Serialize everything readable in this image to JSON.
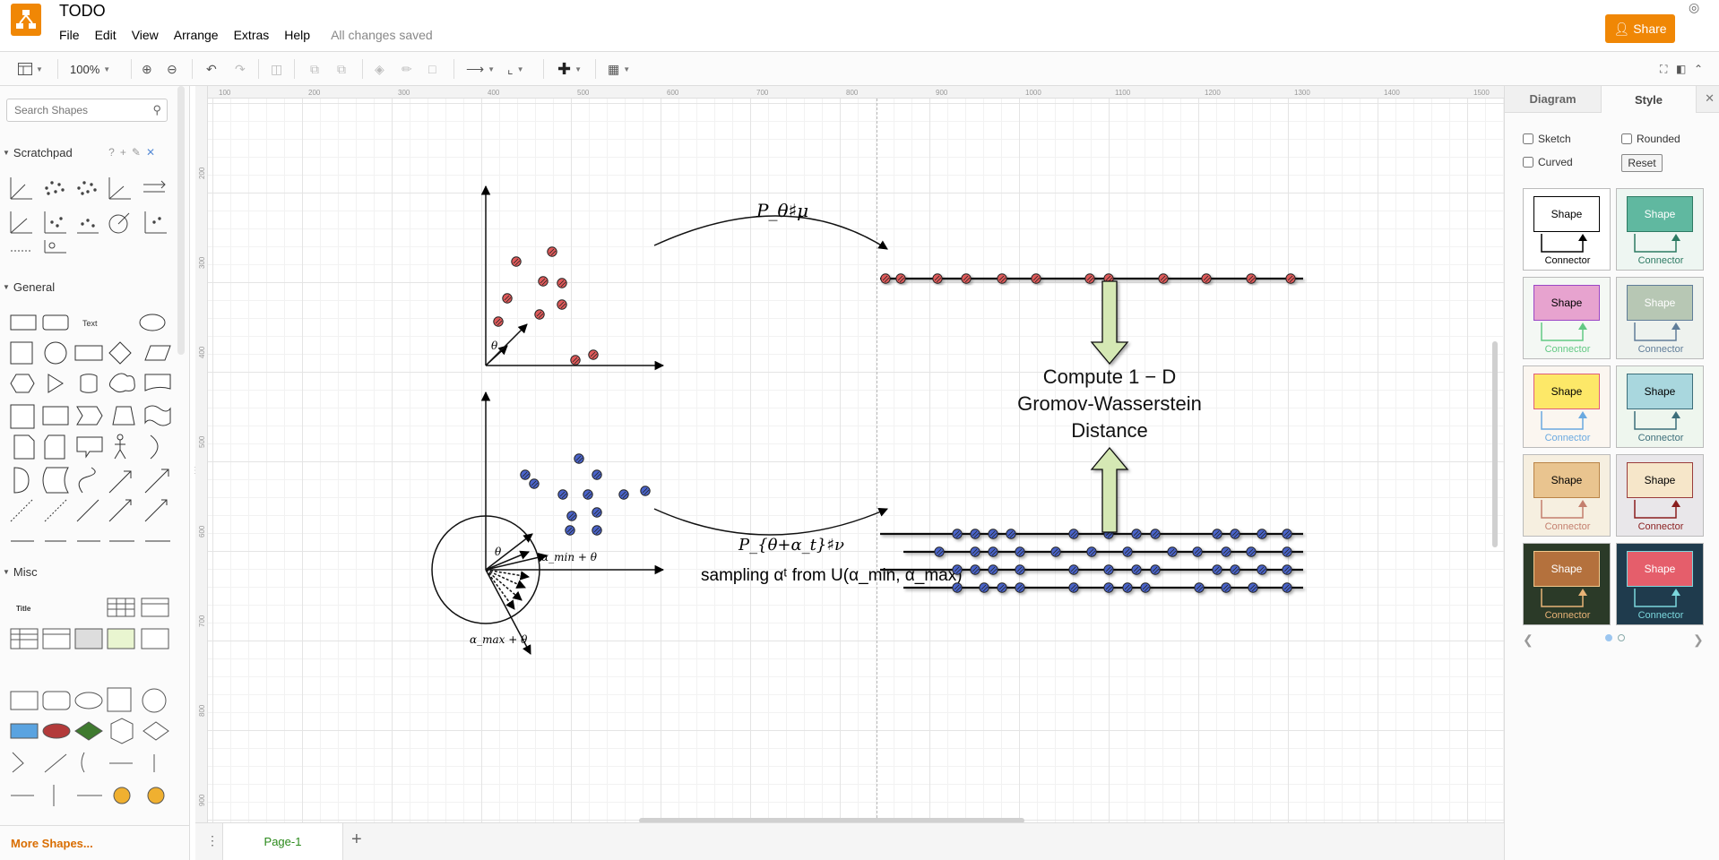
{
  "app": {
    "title": "TODO",
    "menus": [
      "File",
      "Edit",
      "View",
      "Arrange",
      "Extras",
      "Help"
    ],
    "save_status": "All changes saved",
    "share_label": "Share",
    "brand_color": "#f08705"
  },
  "toolbar": {
    "zoom": "100%",
    "icons": [
      "format-panel-icon",
      "zoom-in-icon",
      "zoom-out-icon",
      "undo-icon",
      "redo-icon",
      "delete-icon",
      "to-front-icon",
      "to-back-icon",
      "fill-color-icon",
      "line-color-icon",
      "shadow-icon",
      "connection-icon",
      "waypoints-icon",
      "insert-icon",
      "table-icon",
      "fullscreen-icon",
      "toggle-panel-icon",
      "collapse-icon"
    ]
  },
  "sidebar": {
    "search_placeholder": "Search Shapes",
    "palettes": [
      "Scratchpad",
      "General",
      "Misc"
    ],
    "general_text_label": "Text",
    "misc_title_label": "Title",
    "more_shapes": "More Shapes..."
  },
  "ruler": {
    "top": [
      "100",
      "200",
      "300",
      "400",
      "500",
      "600",
      "700",
      "800",
      "900",
      "1000",
      "1100",
      "1200",
      "1300",
      "1400",
      "1500"
    ],
    "left": [
      "200",
      "300",
      "400",
      "500",
      "600",
      "700",
      "800",
      "900"
    ]
  },
  "diagram": {
    "top_arrow_label": "P_θ♯μ",
    "bottom_arrow_label": "P_{θ+α_t}♯ν",
    "sampling_text": "sampling αᵗ from U(α_min, α_max)",
    "compute_lines": [
      "Compute 1 − D",
      "Gromov-Wasserstein",
      "Distance"
    ],
    "theta_label": "θ",
    "alpha_min_label": "α_min + θ",
    "alpha_max_label": "α_max + θ",
    "red_point_color": "#e05a5a",
    "blue_point_color": "#4a63c9",
    "arrow_fill": "#d5e8b4"
  },
  "pages": {
    "current": "Page-1"
  },
  "format_panel": {
    "tabs": [
      "Diagram",
      "Style"
    ],
    "active_tab": "Style",
    "options": [
      "Sketch",
      "Rounded",
      "Curved"
    ],
    "reset_label": "Reset",
    "shape_label": "Shape",
    "connector_label": "Connector",
    "styles": [
      {
        "fill": "#ffffff",
        "stroke": "#000000",
        "text": "#000000",
        "conn": "#000000",
        "bg": "#ffffff"
      },
      {
        "fill": "#60b8a0",
        "stroke": "#2d7a63",
        "text": "#ffffff",
        "conn": "#2d7a63",
        "bg": "#eef6f2"
      },
      {
        "fill": "#e7a3cf",
        "stroke": "#9b47c6",
        "text": "#000000",
        "conn": "#62c983",
        "bg": "#f4f8f4"
      },
      {
        "fill": "#b7c7b4",
        "stroke": "#607d99",
        "text": "#ffffff",
        "conn": "#607d99",
        "bg": "#eef2ee"
      },
      {
        "fill": "#fde868",
        "stroke": "#e05d7b",
        "text": "#000000",
        "conn": "#6aa9e0",
        "bg": "#fbf6f0"
      },
      {
        "fill": "#a9d7de",
        "stroke": "#3c6e7a",
        "text": "#000000",
        "conn": "#3c6e7a",
        "bg": "#eef6ee"
      },
      {
        "fill": "#e9c48f",
        "stroke": "#b98447",
        "text": "#000000",
        "conn": "#c47f6e",
        "bg": "#f6efe0"
      },
      {
        "fill": "#f6e6c9",
        "stroke": "#9a3b3b",
        "text": "#000000",
        "conn": "#8a1e1e",
        "bg": "#e9e7ea"
      },
      {
        "fill": "#b4713d",
        "stroke": "#f3c98c",
        "text": "#ffffff",
        "conn": "#e8b377",
        "bg": "#2b3a28"
      },
      {
        "fill": "#e55e6b",
        "stroke": "#7bd7dd",
        "text": "#ffffff",
        "conn": "#7bd7dd",
        "bg": "#1f3b4d"
      }
    ]
  }
}
